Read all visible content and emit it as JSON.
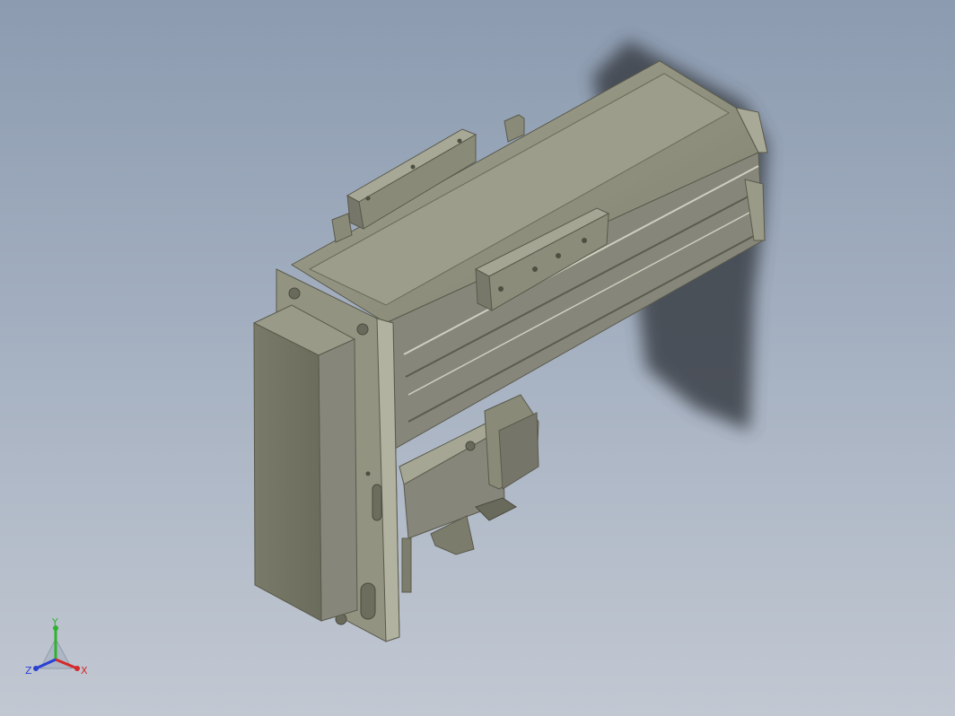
{
  "viewport": {
    "background_top": "#8c9bb0",
    "background_bottom": "#c2c8d2",
    "model_color": "#8b8b78",
    "shadow_color": "#3a3f46"
  },
  "triad": {
    "x_label": "X",
    "y_label": "Y",
    "z_label": "Z",
    "x_color": "#d42a2a",
    "y_color": "#2fb32f",
    "z_color": "#2a3fd4"
  }
}
